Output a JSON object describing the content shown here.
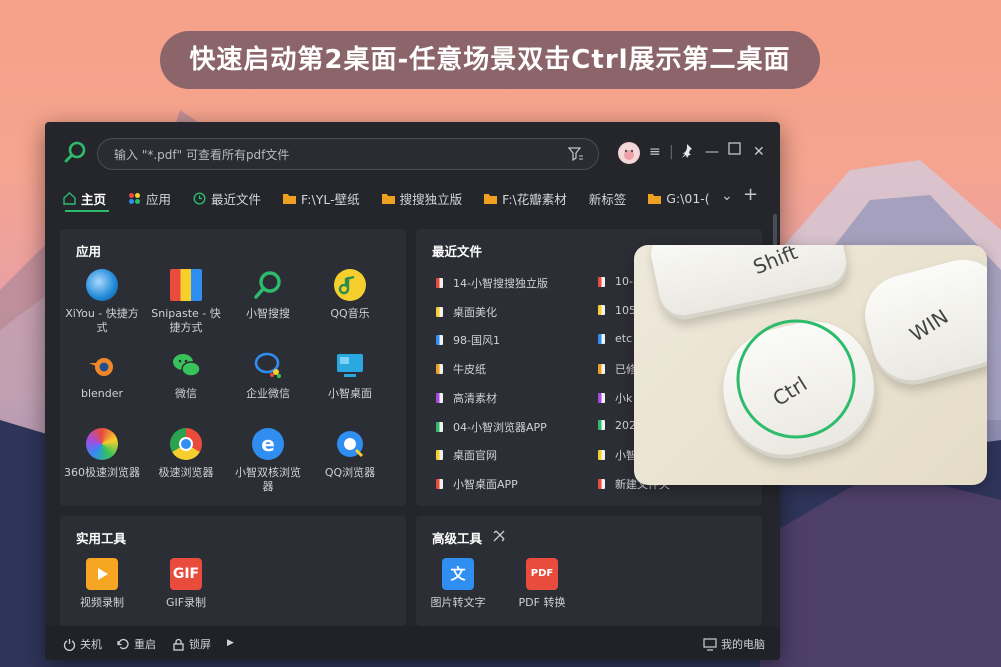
{
  "banner": "快速启动第2桌面-任意场景双击Ctrl展示第二桌面",
  "search": {
    "placeholder": "输入 \"*.pdf\" 可查看所有pdf文件"
  },
  "tabs": [
    {
      "label": "主页",
      "icon": "home-icon",
      "color": "#2dbb6c"
    },
    {
      "label": "应用",
      "icon": "apps-icon",
      "color": "#e6a03c"
    },
    {
      "label": "最近文件",
      "icon": "clock-icon",
      "color": "#2dbb6c"
    },
    {
      "label": "F:\\YL-壁纸",
      "icon": "folder-icon",
      "color": "#f0a020"
    },
    {
      "label": "搜搜独立版",
      "icon": "folder-icon",
      "color": "#f0a020"
    },
    {
      "label": "F:\\花瓣素材",
      "icon": "folder-icon",
      "color": "#f0a020"
    },
    {
      "label": "新标签",
      "icon": "",
      "color": ""
    },
    {
      "label": "G:\\01-(",
      "icon": "folder-icon",
      "color": "#f0a020"
    }
  ],
  "apps_panel": {
    "title": "应用",
    "items": [
      {
        "label": "XiYou - 快捷方式",
        "icon": "xiyou-icon",
        "color": "#1f88d6"
      },
      {
        "label": "Snipaste - 快捷方式",
        "icon": "snipaste-icon",
        "color": "#e94b3c"
      },
      {
        "label": "小智搜搜",
        "icon": "search-app-icon",
        "color": "#2dbb6c"
      },
      {
        "label": "QQ音乐",
        "icon": "qqmusic-icon",
        "color": "#f6cf2f"
      },
      {
        "label": "blender",
        "icon": "blender-icon",
        "color": "#f0872b"
      },
      {
        "label": "微信",
        "icon": "wechat-icon",
        "color": "#38c35a"
      },
      {
        "label": "企业微信",
        "icon": "wecom-icon",
        "color": "#2f8ef0"
      },
      {
        "label": "小智桌面",
        "icon": "desktop-app-icon",
        "color": "#2aa9e0"
      },
      {
        "label": "360极速浏览器",
        "icon": "browser360-icon",
        "color": "#e94b3c"
      },
      {
        "label": "极速浏览器",
        "icon": "chrome-icon",
        "color": "#2aa24f"
      },
      {
        "label": "小智双核浏览器",
        "icon": "ie-browser-icon",
        "color": "#2f8ef0"
      },
      {
        "label": "QQ浏览器",
        "icon": "qqbrowser-icon",
        "color": "#2f8ef0"
      }
    ]
  },
  "recent_panel": {
    "title": "最近文件",
    "col1": [
      "14-小智搜搜独立版",
      "桌面美化",
      "98-国风1",
      "牛皮纸",
      "高清素材",
      "04-小智浏览器APP",
      "桌面官网",
      "小智桌面APP"
    ],
    "col2": [
      "10-",
      "105",
      "etc",
      "已修",
      "小k",
      "202",
      "小智",
      "新建文件夹"
    ]
  },
  "tools_panel": {
    "title": "实用工具",
    "items": [
      {
        "label": "视频录制",
        "icon": "video-record-icon",
        "color": "#f6a623"
      },
      {
        "label": "GIF录制",
        "icon": "gif-icon",
        "color": "#e94b3c",
        "badge": "GIF"
      }
    ]
  },
  "advanced_panel": {
    "title": "高级工具",
    "items": [
      {
        "label": "图片转文字",
        "icon": "ocr-icon",
        "color": "#2f8ef0",
        "badge": "文"
      },
      {
        "label": "PDF 转换",
        "icon": "pdf-icon",
        "color": "#e94b3c",
        "badge": "PDF"
      }
    ]
  },
  "footer": {
    "shutdown": "关机",
    "restart": "重启",
    "lock": "锁屏",
    "mypc": "我的电脑"
  },
  "keyboard": {
    "keys": [
      "Shift",
      "WIN",
      "Ctrl"
    ],
    "highlight_color": "#2dbb6c"
  }
}
